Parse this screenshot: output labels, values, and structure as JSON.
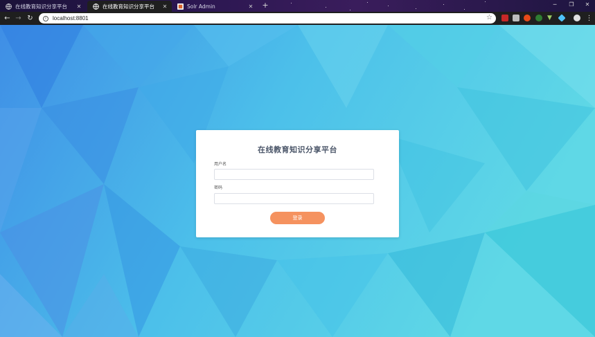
{
  "browser": {
    "tabs": [
      {
        "title": "在线教育知识分享平台",
        "active": false,
        "icon": "globe-icon"
      },
      {
        "title": "在线教育知识分享平台",
        "active": true,
        "icon": "globe-icon"
      },
      {
        "title": "Solr Admin",
        "active": false,
        "icon": "solr-icon"
      }
    ],
    "new_tab_label": "+",
    "url": "localhost:8801"
  },
  "login": {
    "title": "在线教育知识分享平台",
    "username_label": "用户名",
    "username_value": "",
    "password_label": "密码",
    "password_value": "",
    "submit_label": "登录"
  },
  "colors": {
    "accent_button": "#f5925f",
    "background_light": "#5fd6e8",
    "background_dark": "#3a8be6"
  }
}
